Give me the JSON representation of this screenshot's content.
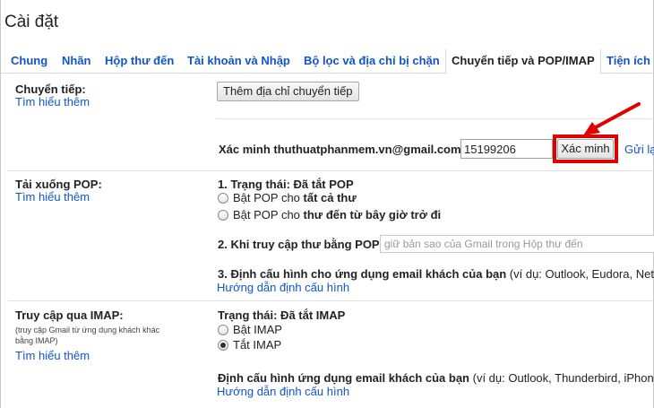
{
  "page": {
    "title": "Cài đặt"
  },
  "tabs": [
    {
      "label": "Chung"
    },
    {
      "label": "Nhãn"
    },
    {
      "label": "Hộp thư đến"
    },
    {
      "label": "Tài khoản và Nhập"
    },
    {
      "label": "Bộ lọc và địa chỉ bị chặn"
    },
    {
      "label": "Chuyển tiếp và POP/IMAP"
    },
    {
      "label": "Tiện ích"
    }
  ],
  "forwarding": {
    "label": "Chuyển tiếp:",
    "learn_more": "Tìm hiểu thêm",
    "add_button": "Thêm địa chỉ chuyển tiếp",
    "verify_label": "Xác minh thuthuatphanmem.vn@gmail.com",
    "code_value": "15199206",
    "verify_button": "Xác minh",
    "resend_link": "Gửi lại"
  },
  "pop": {
    "label": "Tải xuống POP:",
    "learn_more": "Tìm hiểu thêm",
    "status": "1. Trạng thái: Đã tắt POP",
    "option_all_prefix": "Bật POP cho ",
    "option_all_bold": "tất cả thư",
    "option_new_prefix": "Bật POP cho ",
    "option_new_bold": "thư đến từ bây giờ trở đi",
    "access_label": "2. Khi truy cập thư bằng POP",
    "access_select": "giữ bản sao của Gmail trong Hộp thư đến",
    "config_label": "3. Định cấu hình cho ứng dụng email khách của bạn",
    "config_example": " (ví dụ: Outlook, Eudora, Netsc",
    "config_link": "Hướng dẫn định cấu hình"
  },
  "imap": {
    "label": "Truy cập qua IMAP:",
    "sublabel": "(truy cập Gmail từ ứng dụng khách khác bằng IMAP)",
    "learn_more": "Tìm hiểu thêm",
    "status": "Trạng thái: Đã tắt IMAP",
    "option_on": "Bật IMAP",
    "option_off": "Tắt IMAP",
    "config_label": "Định cấu hình ứng dụng email khách của bạn",
    "config_example": " (ví dụ: Outlook, Thunderbird, iPhone)",
    "config_link": "Hướng dẫn định cấu hình"
  },
  "colors": {
    "link": "#1155cc",
    "highlight": "#e00000",
    "arrow": "#e00000"
  }
}
